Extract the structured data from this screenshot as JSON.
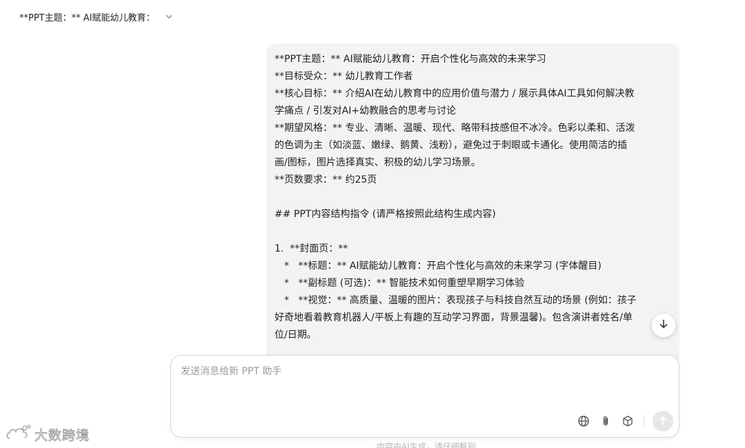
{
  "header": {
    "title": "**PPT主题：** AI赋能幼儿教育：",
    "dropdown_icon": "chevron-down-icon"
  },
  "message": {
    "lines": [
      "**PPT主题：** AI赋能幼儿教育：开启个性化与高效的未来学习",
      "**目标受众：** 幼儿教育工作者",
      "**核心目标：** 介绍AI在幼儿教育中的应用价值与潜力 / 展示具体AI工具如何解决教",
      "学痛点 / 引发对AI+幼教融合的思考与讨论",
      "**期望风格：** 专业、清晰、温暖、现代、略带科技感但不冰冷。色彩以柔和、活泼",
      "的色调为主（如淡蓝、嫩绿、鹅黄、浅粉），避免过于刺眼或卡通化。使用简洁的插",
      "画/图标，图片选择真实、积极的幼儿学习场景。",
      "**页数要求：** 约25页",
      "## PPT内容结构指令 (请严格按照此结构生成内容)",
      "1.  **封面页：**",
      "*   **标题：** AI赋能幼儿教育：开启个性化与高效的未来学习 (字体醒目)",
      "*   **副标题 (可选)：** 智能技术如何重塑早期学习体验",
      "*   **视觉：** 高质量、温暖的图片：表现孩子与科技自然互动的场景 (例如：孩子",
      "好奇地看着教育机器人/平板上有趣的互动学习界面，背景温馨)。包含演讲者姓名/单",
      "位/日期。"
    ]
  },
  "composer": {
    "placeholder": "发送消息给新 PPT 助手",
    "value": "",
    "tools": [
      "globe-icon",
      "paperclip-icon",
      "cube-icon"
    ],
    "send_icon": "arrow-up-icon"
  },
  "scroll_down_icon": "arrow-down-icon",
  "footer_note": "内容由AI生成，请仔细甄别",
  "watermark": {
    "text": "大数跨境",
    "logo_icon": "cloud-logo-icon"
  }
}
